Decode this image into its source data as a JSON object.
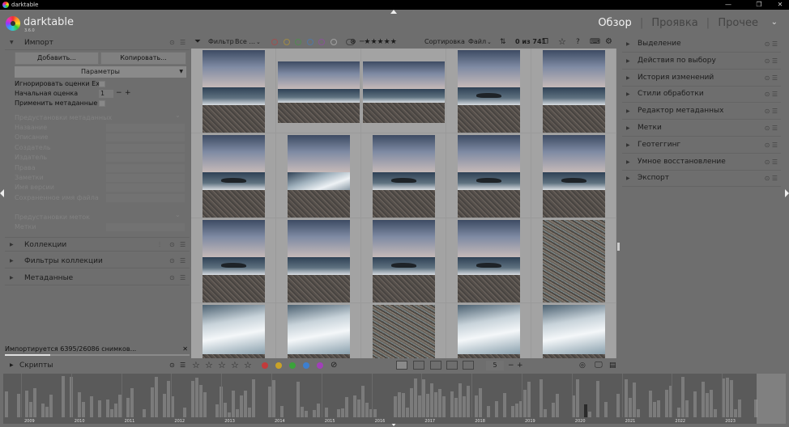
{
  "window": {
    "title": "darktable"
  },
  "app": {
    "name": "darktable",
    "version": "3.6.0"
  },
  "views": [
    {
      "label": "Обзор",
      "active": true
    },
    {
      "label": "Проявка",
      "active": false
    },
    {
      "label": "Прочее",
      "active": false
    }
  ],
  "left": {
    "import": {
      "title": "Импорт",
      "add_label": "Добавить...",
      "copy_label": "Копировать...",
      "params_label": "Параметры",
      "ignore_exif_label": "Игнорировать оценки Exif",
      "initial_rating_label": "Начальная оценка",
      "initial_rating_value": "1",
      "apply_metadata_label": "Применить метаданные",
      "metadata_preset_label": "Предустановки метаданных",
      "fields": [
        "Название",
        "Описание",
        "Создатель",
        "Издатель",
        "Права",
        "Заметки",
        "Имя версии",
        "Сохраненное имя файла"
      ],
      "tags_preset_label": "Предустановки меток",
      "tags_label": "Метки"
    },
    "modules": [
      "Коллекции",
      "Фильтры коллекции",
      "Метаданные"
    ],
    "progress_text": "Импортируется 6395/26086 снимков...",
    "progress_fraction": 0.245,
    "scripts_label": "Скрипты"
  },
  "toolbar": {
    "filter_label": "Фильтр",
    "filter_value": "Все ...",
    "sort_label": "Сортировка",
    "sort_value": "Файл",
    "count": "0 из 741",
    "color_labels": [
      "#c23b3b",
      "#c9a227",
      "#3aa33a",
      "#3d7fcf",
      "#a040b8"
    ]
  },
  "right": {
    "modules": [
      "Выделение",
      "Действия по выбору",
      "История изменений",
      "Стили обработки",
      "Редактор метаданных",
      "Метки",
      "Геотеггинг",
      "Умное восстановление",
      "Экспорт"
    ]
  },
  "bottom": {
    "zoom": "5",
    "color_labels": [
      "#c23b3b",
      "#c9a227",
      "#3aa33a",
      "#3d7fcf",
      "#a040b8"
    ]
  },
  "timeline": {
    "years": [
      "2009",
      "2010",
      "2011",
      "2012",
      "2013",
      "2014",
      "2015",
      "2016",
      "2017",
      "2018",
      "2019",
      "2020",
      "2021",
      "2022",
      "2023"
    ]
  },
  "grid": {
    "thumbnails": [
      "beach",
      "wide",
      "wide",
      "rock",
      "beach",
      "rock",
      "foam",
      "rock",
      "rock",
      "rock",
      "rock",
      "beach",
      "rock",
      "rock",
      "pebble",
      "wave",
      "wave",
      "pebble",
      "wave",
      "wave"
    ]
  }
}
